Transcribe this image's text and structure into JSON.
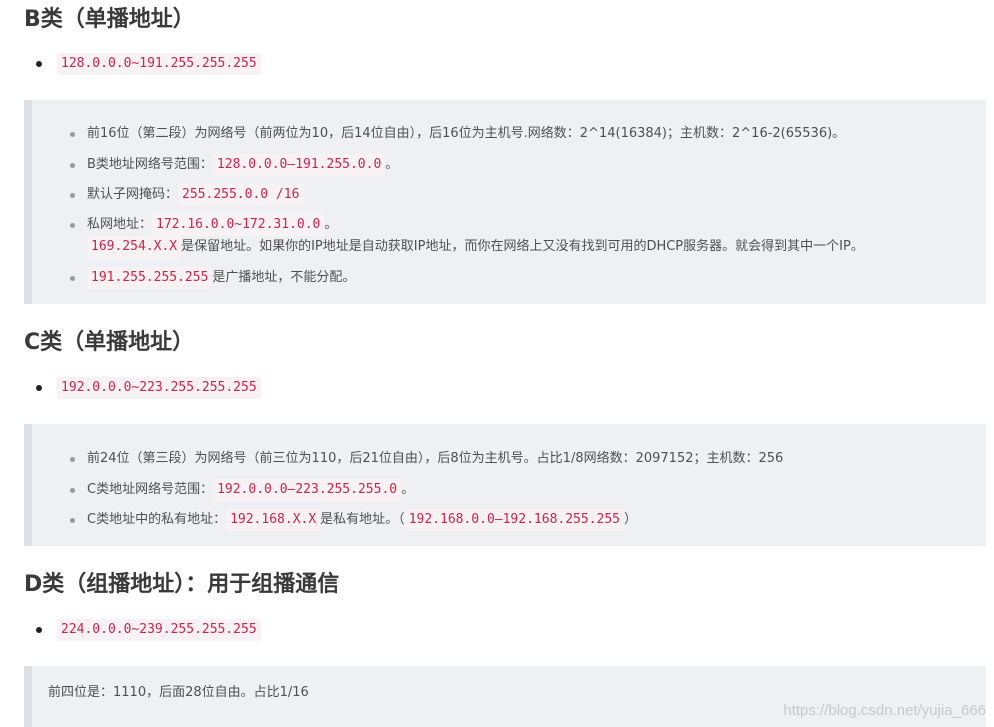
{
  "sections": {
    "b": {
      "heading": "B类（单播地址）",
      "range": "128.0.0.0~191.255.255.255",
      "quote": {
        "item1": "前16位（第二段）为网络号（前两位为10，后14位自由），后16位为主机号.网络数：2^14(16384)；主机数：2^16-2(65536)。",
        "item2_label": "B类地址网络号范围：",
        "item2_code": "128.0.0.0—191.255.0.0",
        "item2_suffix": "。",
        "item3_label": "默认子网掩码：",
        "item3_code": "255.255.0.0 /16",
        "item4_label": "私网地址：",
        "item4_code": "172.16.0.0~172.31.0.0",
        "item4_suffix": "。",
        "item4_line2_code": "169.254.X.X",
        "item4_line2_text": "是保留地址。如果你的IP地址是自动获取IP地址，而你在网络上又没有找到可用的DHCP服务器。就会得到其中一个IP。",
        "item5_code": "191.255.255.255",
        "item5_text": "是广播地址，不能分配。"
      }
    },
    "c": {
      "heading": "C类（单播地址）",
      "range": "192.0.0.0~223.255.255.255",
      "quote": {
        "item1": "前24位（第三段）为网络号（前三位为110，后21位自由），后8位为主机号。占比1/8网络数：2097152；主机数：256",
        "item2_label": "C类地址网络号范围：",
        "item2_code": "192.0.0.0—223.255.255.0",
        "item2_suffix": "。",
        "item3_label": "C类地址中的私有地址：",
        "item3_code1": "192.168.X.X",
        "item3_mid": "是私有地址。（",
        "item3_code2": "192.168.0.0—192.168.255.255",
        "item3_suffix": "）"
      }
    },
    "d": {
      "heading": "D类（组播地址）：用于组播通信",
      "range": "224.0.0.0~239.255.255.255",
      "quote": {
        "text": "前四位是：1110，后面28位自由。占比1/16"
      }
    }
  },
  "watermark": "https://blog.csdn.net/yujia_666"
}
